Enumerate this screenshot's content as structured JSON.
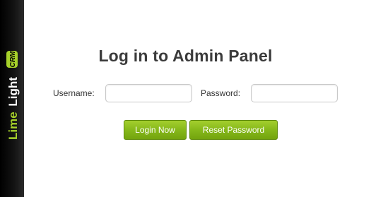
{
  "brand": {
    "logo_text_lime": "Lime",
    "logo_text_light": "Light",
    "logo_badge": "CRM",
    "colors": {
      "lime": "#a6d12a",
      "light": "#ffffff",
      "badge_bg": "#a6d12a",
      "badge_text": "#000000"
    }
  },
  "login": {
    "title": "Log in to Admin Panel",
    "username_label": "Username:",
    "username_value": "",
    "password_label": "Password:",
    "password_value": "",
    "login_button": "Login Now",
    "reset_button": "Reset Password"
  },
  "colors": {
    "button_green": "#86b81a",
    "title_text": "#3b3b3b",
    "sidebar_bg": "#000000"
  }
}
